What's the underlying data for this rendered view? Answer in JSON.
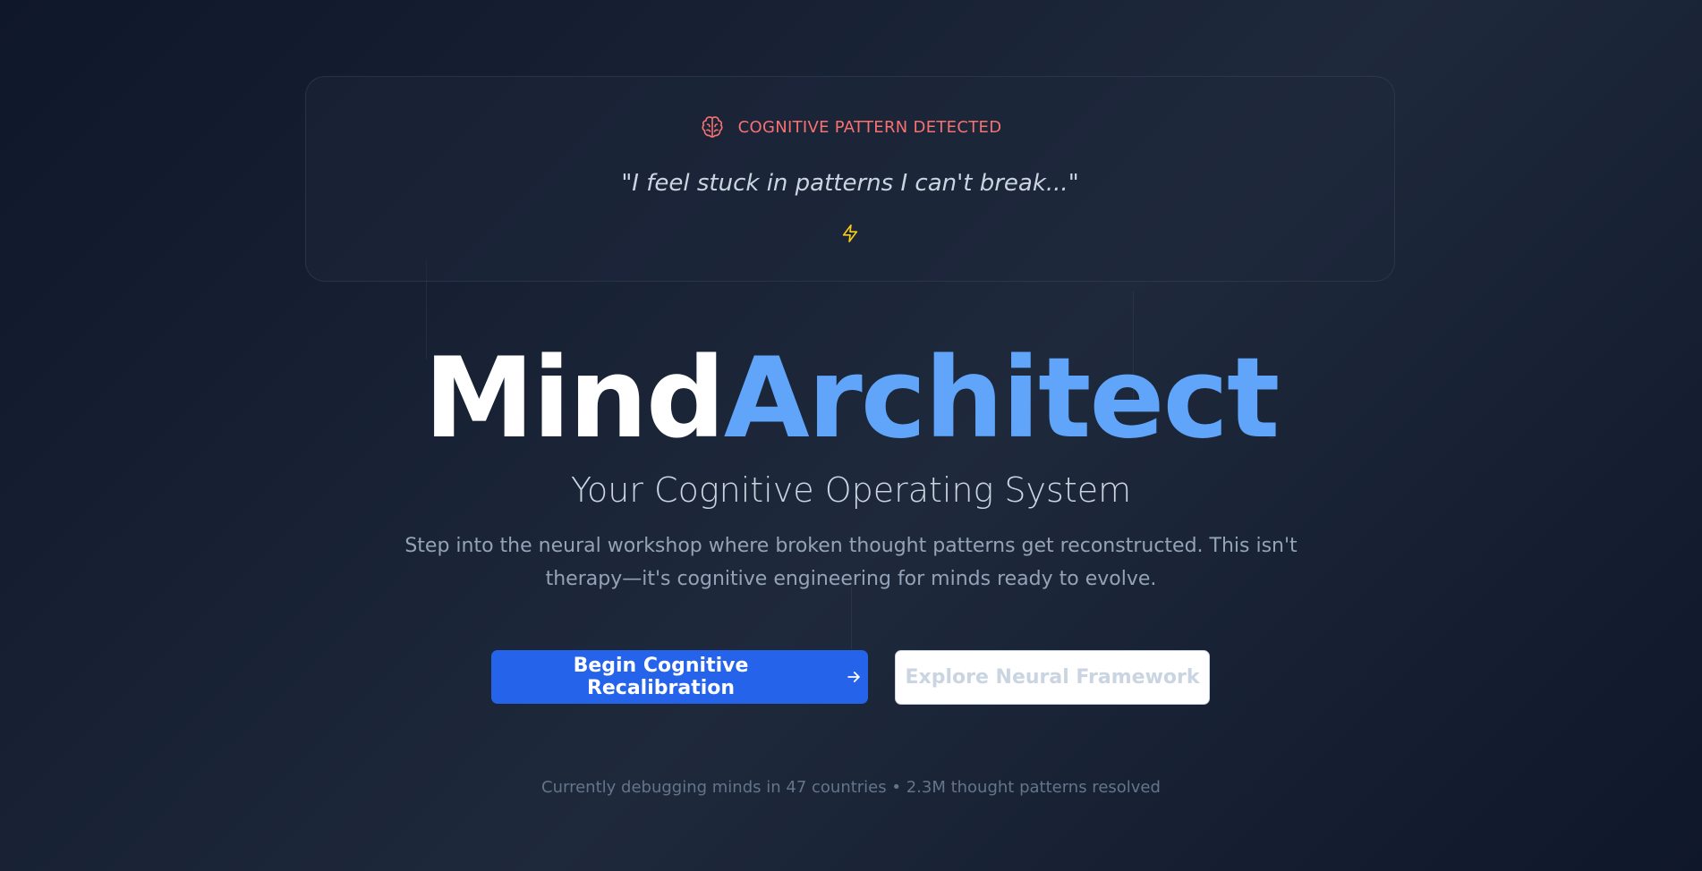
{
  "alert": {
    "icon": "brain-icon",
    "label": "COGNITIVE PATTERN DETECTED",
    "quote": "\"I feel stuck in patterns I can't break...\"",
    "secondary_icon": "lightning-bolt-icon",
    "label_color": "#f87171",
    "bolt_color": "#facc15"
  },
  "hero": {
    "title_part1": "Mind",
    "title_part2": "Architect",
    "subtitle": "Your Cognitive Operating System",
    "description": "Step into the neural workshop where broken thought patterns get reconstructed. This isn't therapy—it's cognitive engineering for minds ready to evolve.",
    "accent_color": "#60a5fa"
  },
  "actions": {
    "primary_label": "Begin Cognitive Recalibration",
    "primary_icon": "arrow-right-icon",
    "primary_color": "#2563eb",
    "secondary_label": "Explore Neural Framework"
  },
  "footer": {
    "stats": "Currently debugging minds in 47 countries • 2.3M thought patterns resolved"
  }
}
